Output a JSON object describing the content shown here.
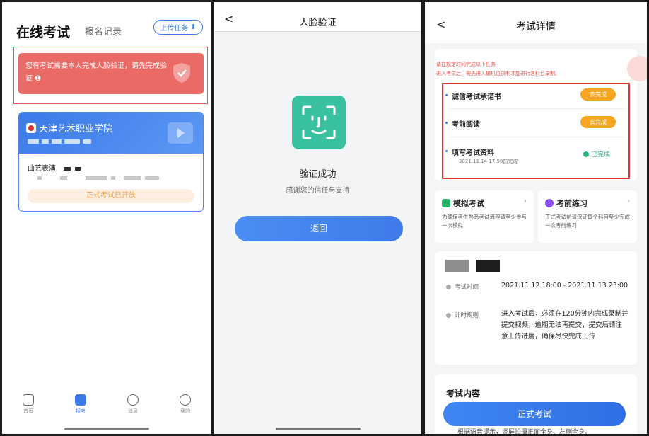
{
  "panel1": {
    "title": "在线考试",
    "tab_label": "报名记录",
    "upload_label": "上传任务",
    "alert_text": "您有考试需要本人完成人脸验证，请先完成验证 ❶",
    "school_name": "天津艺术职业学院",
    "major": "曲艺表演",
    "status_label": "正式考试已开放",
    "tabs": [
      {
        "label": "首页"
      },
      {
        "label": "报考"
      },
      {
        "label": "消息"
      },
      {
        "label": "我的"
      }
    ]
  },
  "panel2": {
    "title": "人脸验证",
    "back_label": "<",
    "success_text": "验证成功",
    "sub_text": "感谢您的信任与支持",
    "return_label": "返回"
  },
  "panel3": {
    "back_label": "<",
    "title": "考试详情",
    "notice_line1": "请在规定时间完成以下任务",
    "notice_line2": "进入考试后，需先进入辅机位录制才能进行各科目录制。",
    "tasks": [
      {
        "name": "诚信考试承诺书",
        "action": "去完成"
      },
      {
        "name": "考前阅读",
        "action": "去完成"
      },
      {
        "name": "填写考试资料",
        "status": "已完成",
        "time": "2021.11.14 17:59前完成"
      }
    ],
    "mock_title": "模拟考试",
    "mock_desc": "为确保考生熟悉考试流程请至少参与一次模拟",
    "practice_title": "考前练习",
    "practice_desc": "正式考试前请保证每个科目至少完成一次考前练习",
    "exam_time_label": "考试时间",
    "exam_time_value": "2021.11.12 18:00 - 2021.11.13 23:00",
    "timing_label": "计时规则",
    "timing_value": "进入考试后，必须在120分钟内完成录制并提交视频，逾期无法再提交，提交后请注意上传进度，确保尽快完成上传",
    "content_title": "考试内容",
    "exam_button": "正式考试",
    "footer_text": "根据语音提示，竖屏拍摄正面全身、左侧全身、"
  },
  "colors": {
    "accent": "#3b7ae8",
    "alert": "#ea6a66",
    "highlight_border": "#e03330",
    "pending": "#f6a623",
    "done": "#25b37c"
  }
}
